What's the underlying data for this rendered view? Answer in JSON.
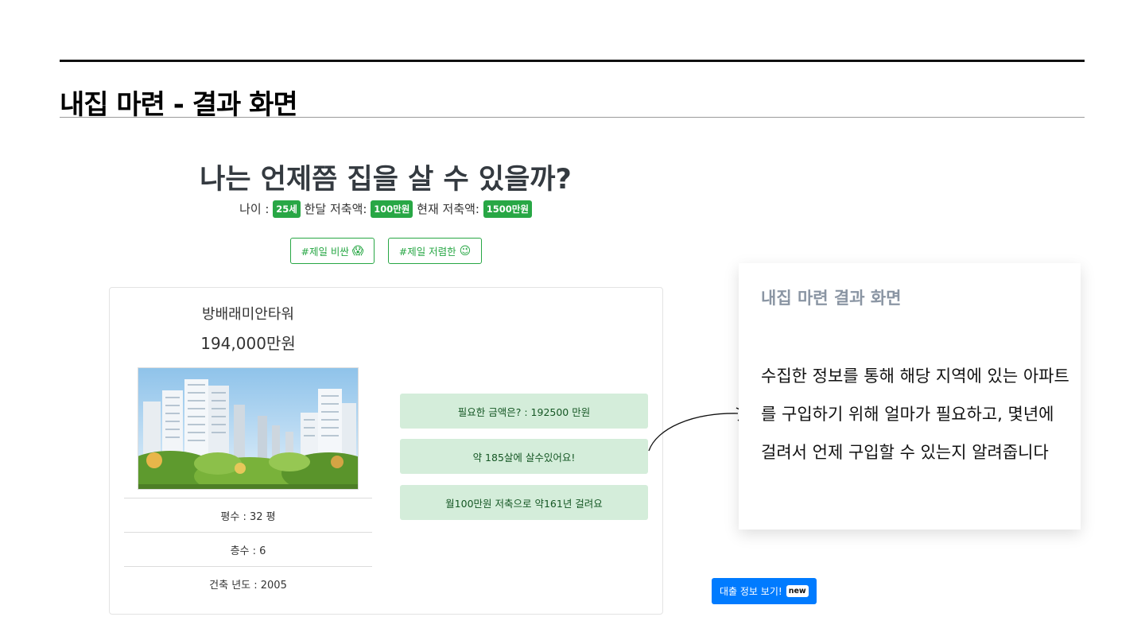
{
  "slide": {
    "title": "내집 마련 - 결과 화면"
  },
  "app": {
    "heading": "나는 언제쯤 집을 살 수 있을까?",
    "age_label": "나이 : ",
    "age_value": "25세",
    "monthly_label": " 한달 저축액: ",
    "monthly_value": "100만원",
    "current_label": " 현재 저축액: ",
    "current_value": "1500만원",
    "tags": [
      {
        "label": "#제일 비싼",
        "icon": "screaming-face-emoji",
        "glyph": "😱"
      },
      {
        "label": "#제일 저렴한",
        "icon": "winking-face-emoji",
        "glyph": "😉"
      }
    ],
    "card": {
      "apt_name": "방배래미안타워",
      "apt_price": "194,000만원",
      "image": "apartment-complex-photo",
      "details": [
        "평수 : 32 평",
        "층수 : 6",
        "건축 년도 : 2005"
      ],
      "results": [
        "필요한 금액은? : 192500 만원",
        "약 185살에 살수있어요!",
        "월100만원 저축으로 약161년 걸려요"
      ]
    },
    "loan_button": {
      "label": "대출 정보 보기!",
      "badge": "new"
    }
  },
  "note": {
    "title": "내집 마련 결과 화면",
    "body": "수집한 정보를 통해 해당 지역에 있는 아파트를 구입하기 위해 얼마가 필요하고, 몇년에 걸려서 언제 구입할 수 있는지 알려줍니다"
  },
  "colors": {
    "success": "#28a745",
    "success_light": "#d4edda",
    "success_text": "#155724",
    "primary": "#007bff",
    "heading": "#343a40",
    "note_title": "#8a95a3"
  }
}
